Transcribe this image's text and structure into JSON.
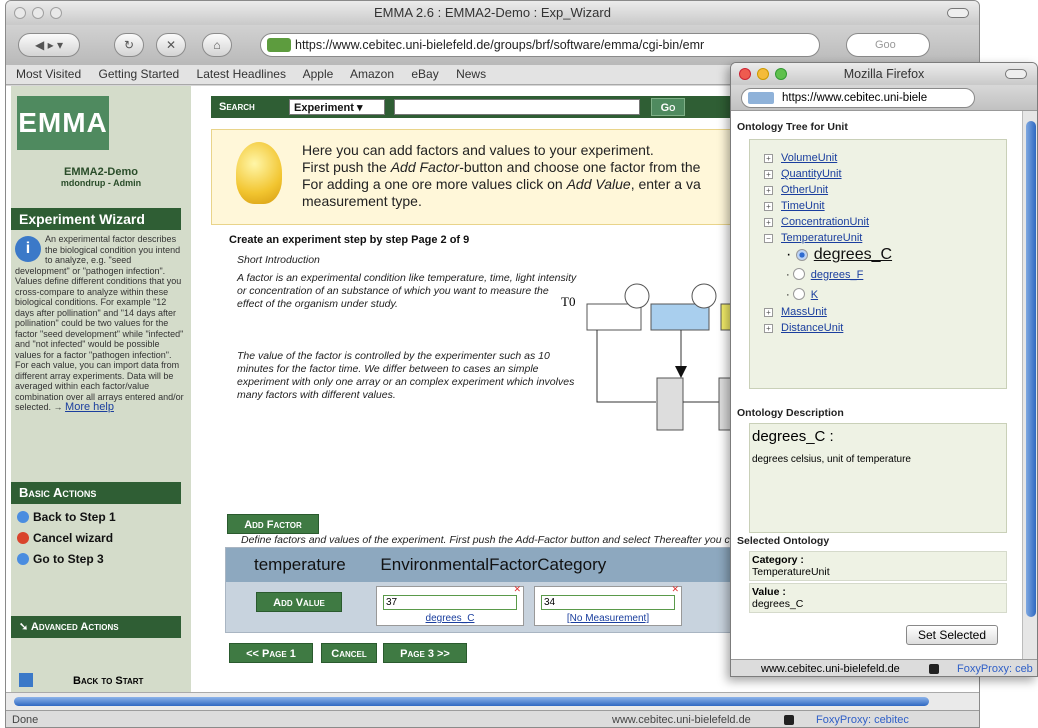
{
  "main_window": {
    "title": "EMMA 2.6 : EMMA2-Demo : Exp_Wizard",
    "url": "https://www.cebitec.uni-bielefeld.de/groups/brf/software/emma/cgi-bin/emr",
    "search_engine": "Goo",
    "bookmarks": [
      "Most Visited",
      "Getting Started",
      "Latest Headlines",
      "Apple",
      "Amazon",
      "eBay",
      "News"
    ],
    "status_left": "Done",
    "status_host": "www.cebitec.uni-bielefeld.de",
    "status_proxy": "FoxyProxy: cebitec"
  },
  "sidebar": {
    "logo": "EMMA",
    "project": "EMMA2-Demo",
    "user": "mdondrup - Admin",
    "wizard_title": "Experiment Wizard",
    "info_text": "An experimental factor describes the biological condition you intend to analyze, e.g. \"seed development\" or \"pathogen infection\". Values define different conditions that you cross-compare to analyze within these biological conditions. For example \"12 days after pollination\" and \"14 days after pollination\" could be two values for the factor \"seed development\" while \"infected\" and \"not infected\" would be possible values for a factor \"pathogen infection\". For each value, you can import data from different array experiments. Data will be averaged within each factor/value combination over all arrays entered and/or selected. →",
    "more_help": "More help",
    "basic_actions": "Basic Actions",
    "actions": [
      {
        "label": "Back to Step 1",
        "color": "#4a8de0"
      },
      {
        "label": "Cancel wizard",
        "color": "#d9442c"
      },
      {
        "label": "Go to Step 3",
        "color": "#4a8de0"
      }
    ],
    "advanced_actions": "Advanced Actions",
    "back_to_start": "Back to Start"
  },
  "search": {
    "label": "Search",
    "select": "Experiment",
    "go": "Go"
  },
  "hint": {
    "line1": "Here you can add factors and values to your experiment.",
    "line2a": "First push the ",
    "line2b": "Add Factor",
    "line2c": "-button and choose one factor from the",
    "line3a": "For adding a one ore more values click on ",
    "line3b": "Add Value",
    "line3c": ", enter a va",
    "line4": "measurement type."
  },
  "step": {
    "title": "Create an experiment step by step Page 2 of 9",
    "intro": "Short Introduction",
    "factor_para": "A factor is an experimental condition like temperature, time, light intensity or concentration of an substance of which you want to measure the effect of the organism under study.",
    "value_para": "The value of the factor is controlled by the experimenter such as 10 minutes for the factor time. We differ between to cases an simple experiment with only one array or an complex experiment which involves many factors with different values.",
    "define_para": "Define factors and values of the experiment. First push the Add-Factor button and select Thereafter you can define as many values you need for this factor by pushing the Add-V textfield and choose a measurement type by following the link below. When you ne process."
  },
  "diagram": {
    "t0": "T0"
  },
  "add_factor": "Add Factor",
  "factor": {
    "name": "temperature",
    "category": "EnvironmentalFactorCategory",
    "add_value": "Add Value",
    "values": [
      {
        "value": "37",
        "unit": "degrees_C"
      },
      {
        "value": "34",
        "unit": "[No Measurement]"
      }
    ]
  },
  "paging": {
    "prev": "<< Page 1",
    "cancel": "Cancel",
    "next": "Page 3 >>"
  },
  "popup": {
    "title": "Mozilla Firefox",
    "url": "https://www.cebitec.uni-biele",
    "tree_title": "Ontology Tree for Unit",
    "tree_nodes_top": [
      "VolumeUnit",
      "QuantityUnit",
      "OtherUnit",
      "TimeUnit",
      "ConcentrationUnit",
      "TemperatureUnit"
    ],
    "leaves": [
      {
        "label": "degrees_C",
        "selected": true
      },
      {
        "label": "degrees_F",
        "selected": false
      },
      {
        "label": "K",
        "selected": false
      }
    ],
    "tree_nodes_bottom": [
      "MassUnit",
      "DistanceUnit"
    ],
    "desc_title": "Ontology Description",
    "desc_heading": "degrees_C :",
    "desc_text": "degrees celsius, unit of temperature",
    "selected_title": "Selected Ontology",
    "category_label": "Category :",
    "category_value": "TemperatureUnit",
    "value_label": "Value :",
    "value_value": "degrees_C",
    "set_selected": "Set Selected",
    "status_host": "www.cebitec.uni-bielefeld.de",
    "status_proxy": "FoxyProxy: ceb"
  }
}
